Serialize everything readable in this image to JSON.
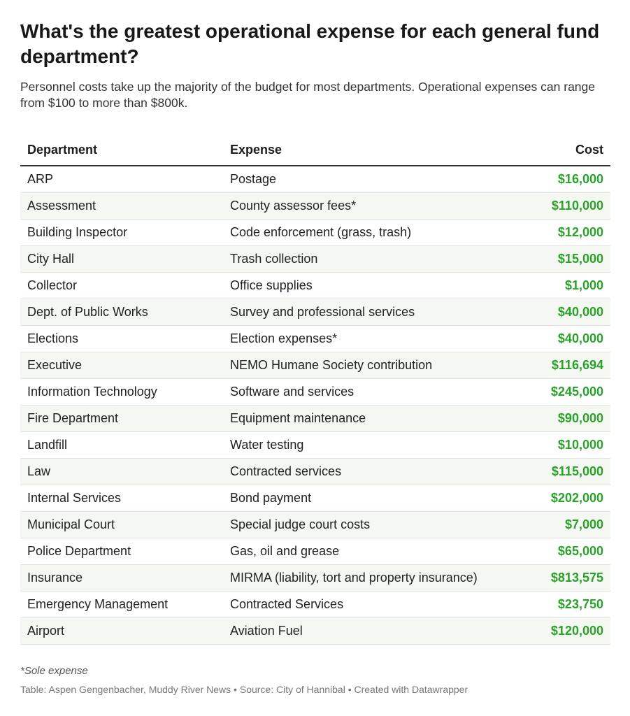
{
  "header": {
    "title": "What's the greatest operational expense for each general fund department?",
    "subtitle": "Personnel costs take up the majority of the budget for most departments. Operational expenses can range from $100 to more than $800k."
  },
  "chart_data": {
    "type": "table",
    "columns": [
      "Department",
      "Expense",
      "Cost"
    ],
    "rows": [
      [
        "ARP",
        "Postage",
        "$16,000"
      ],
      [
        "Assessment",
        "County assessor fees*",
        "$110,000"
      ],
      [
        "Building Inspector",
        "Code enforcement (grass, trash)",
        "$12,000"
      ],
      [
        "City Hall",
        "Trash collection",
        "$15,000"
      ],
      [
        "Collector",
        "Office supplies",
        "$1,000"
      ],
      [
        "Dept. of Public Works",
        "Survey and professional services",
        "$40,000"
      ],
      [
        "Elections",
        "Election expenses*",
        "$40,000"
      ],
      [
        "Executive",
        "NEMO Humane Society contribution",
        "$116,694"
      ],
      [
        "Information Technology",
        "Software and services",
        "$245,000"
      ],
      [
        "Fire Department",
        "Equipment maintenance",
        "$90,000"
      ],
      [
        "Landfill",
        "Water testing",
        "$10,000"
      ],
      [
        "Law",
        "Contracted services",
        "$115,000"
      ],
      [
        "Internal Services",
        "Bond payment",
        "$202,000"
      ],
      [
        "Municipal Court",
        "Special judge court costs",
        "$7,000"
      ],
      [
        "Police Department",
        "Gas, oil and grease",
        "$65,000"
      ],
      [
        "Insurance",
        "MIRMA (liability, tort and property insurance)",
        "$813,575"
      ],
      [
        "Emergency Management",
        "Contracted Services",
        "$23,750"
      ],
      [
        "Airport",
        "Aviation Fuel",
        "$120,000"
      ]
    ]
  },
  "colors": {
    "cost_text": "#2aa22a",
    "alt_row": "#f5f7f2",
    "header_rule": "#333333"
  },
  "notes": "*Sole expense",
  "footer": "Table: Aspen Gengenbacher, Muddy River News • Source: City of Hannibal • Created with Datawrapper"
}
